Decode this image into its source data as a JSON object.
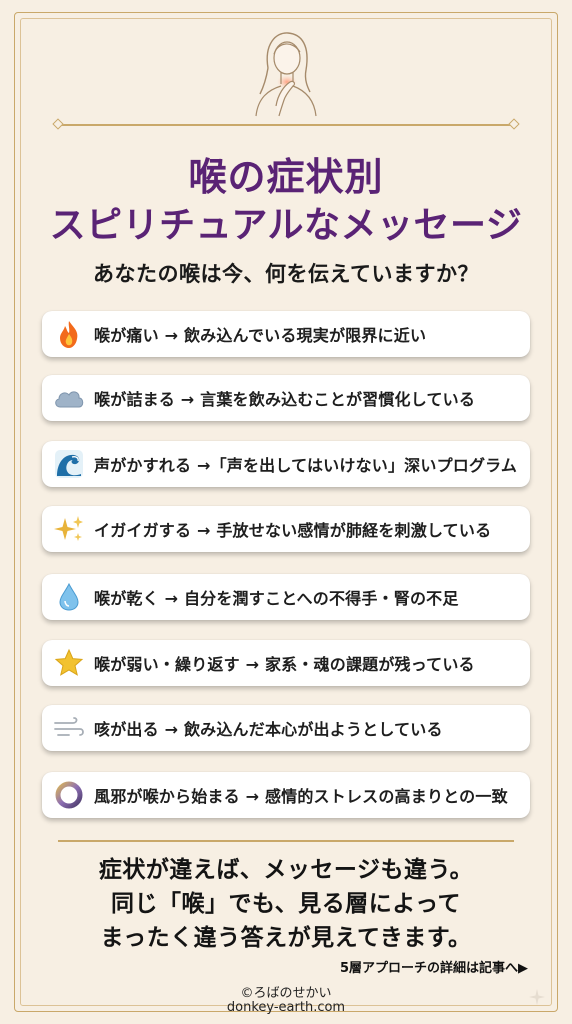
{
  "title": {
    "line1": "喉の症状別",
    "line2": "スピリチュアルなメッセージ"
  },
  "subtitle": "あなたの喉は今、何を伝えていますか？",
  "cards": [
    {
      "icon": "fire-icon",
      "text": "喉が痛い → 飲み込んでいる現実が限界に近い"
    },
    {
      "icon": "cloud-icon",
      "text": "喉が詰まる → 言葉を飲み込むことが習慣化している"
    },
    {
      "icon": "wave-icon",
      "text": "声がかすれる →「声を出してはいけない」深いプログラム"
    },
    {
      "icon": "sparkles-icon",
      "text": "イガイガする → 手放せない感情が肺経を刺激している"
    },
    {
      "icon": "droplet-icon",
      "text": "喉が乾く → 自分を潤すことへの不得手・腎の不足"
    },
    {
      "icon": "star-icon",
      "text": "喉が弱い・繰り返す → 家系・魂の課題が残っている"
    },
    {
      "icon": "wind-icon",
      "text": "咳が出る → 飲み込んだ本心が出ようとしている"
    },
    {
      "icon": "ring-icon",
      "text": "風邪が喉から始まる → 感情的ストレスの高まりとの一致"
    }
  ],
  "closing": {
    "line1": "症状が違えば、メッセージも違う。",
    "line2": "同じ「喉」でも、見る層によって",
    "line3": "まったく違う答えが見えてきます。"
  },
  "article_link": "5層アプローチの詳細は記事へ▶",
  "footer": {
    "copyright": "©ろばのせかい",
    "site": "donkey-earth.com"
  },
  "colors": {
    "background": "#f7efe3",
    "accent_gold": "#c9a86a",
    "title_purple": "#5a2375"
  }
}
